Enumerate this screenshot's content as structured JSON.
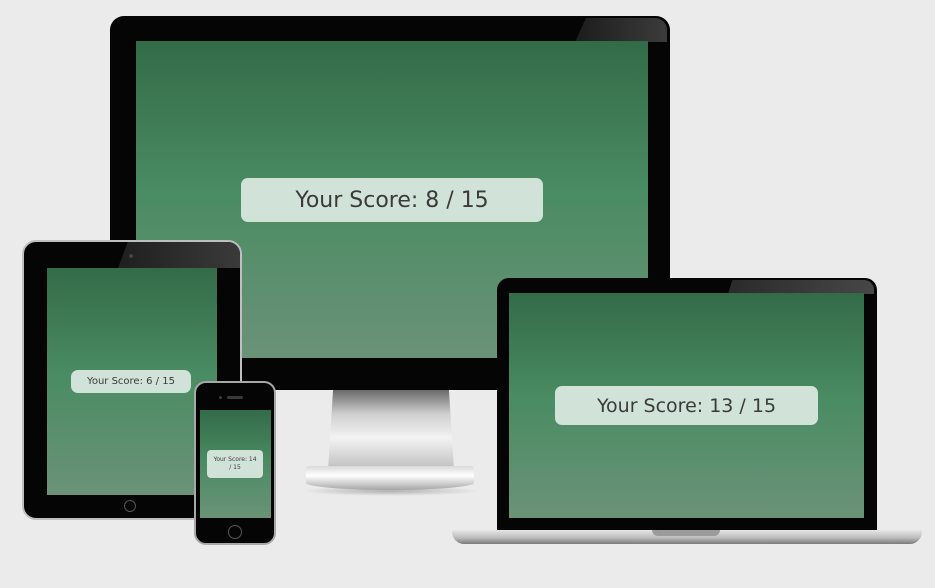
{
  "devices": {
    "monitor": {
      "score_text": "Your Score: 8 / 15"
    },
    "tablet": {
      "score_text": "Your Score: 6 / 15"
    },
    "laptop": {
      "score_text": "Your Score: 13 / 15"
    },
    "phone": {
      "score_line1": "Your Score: 14",
      "score_line2": "/ 15"
    }
  },
  "colors": {
    "background": "#ebebeb",
    "screen_gradient_top": "#336b48",
    "screen_gradient_mid": "#4a8c63",
    "screen_gradient_bottom": "#6b9278",
    "score_box": "#d1e2d9",
    "bezel": "#050505"
  }
}
